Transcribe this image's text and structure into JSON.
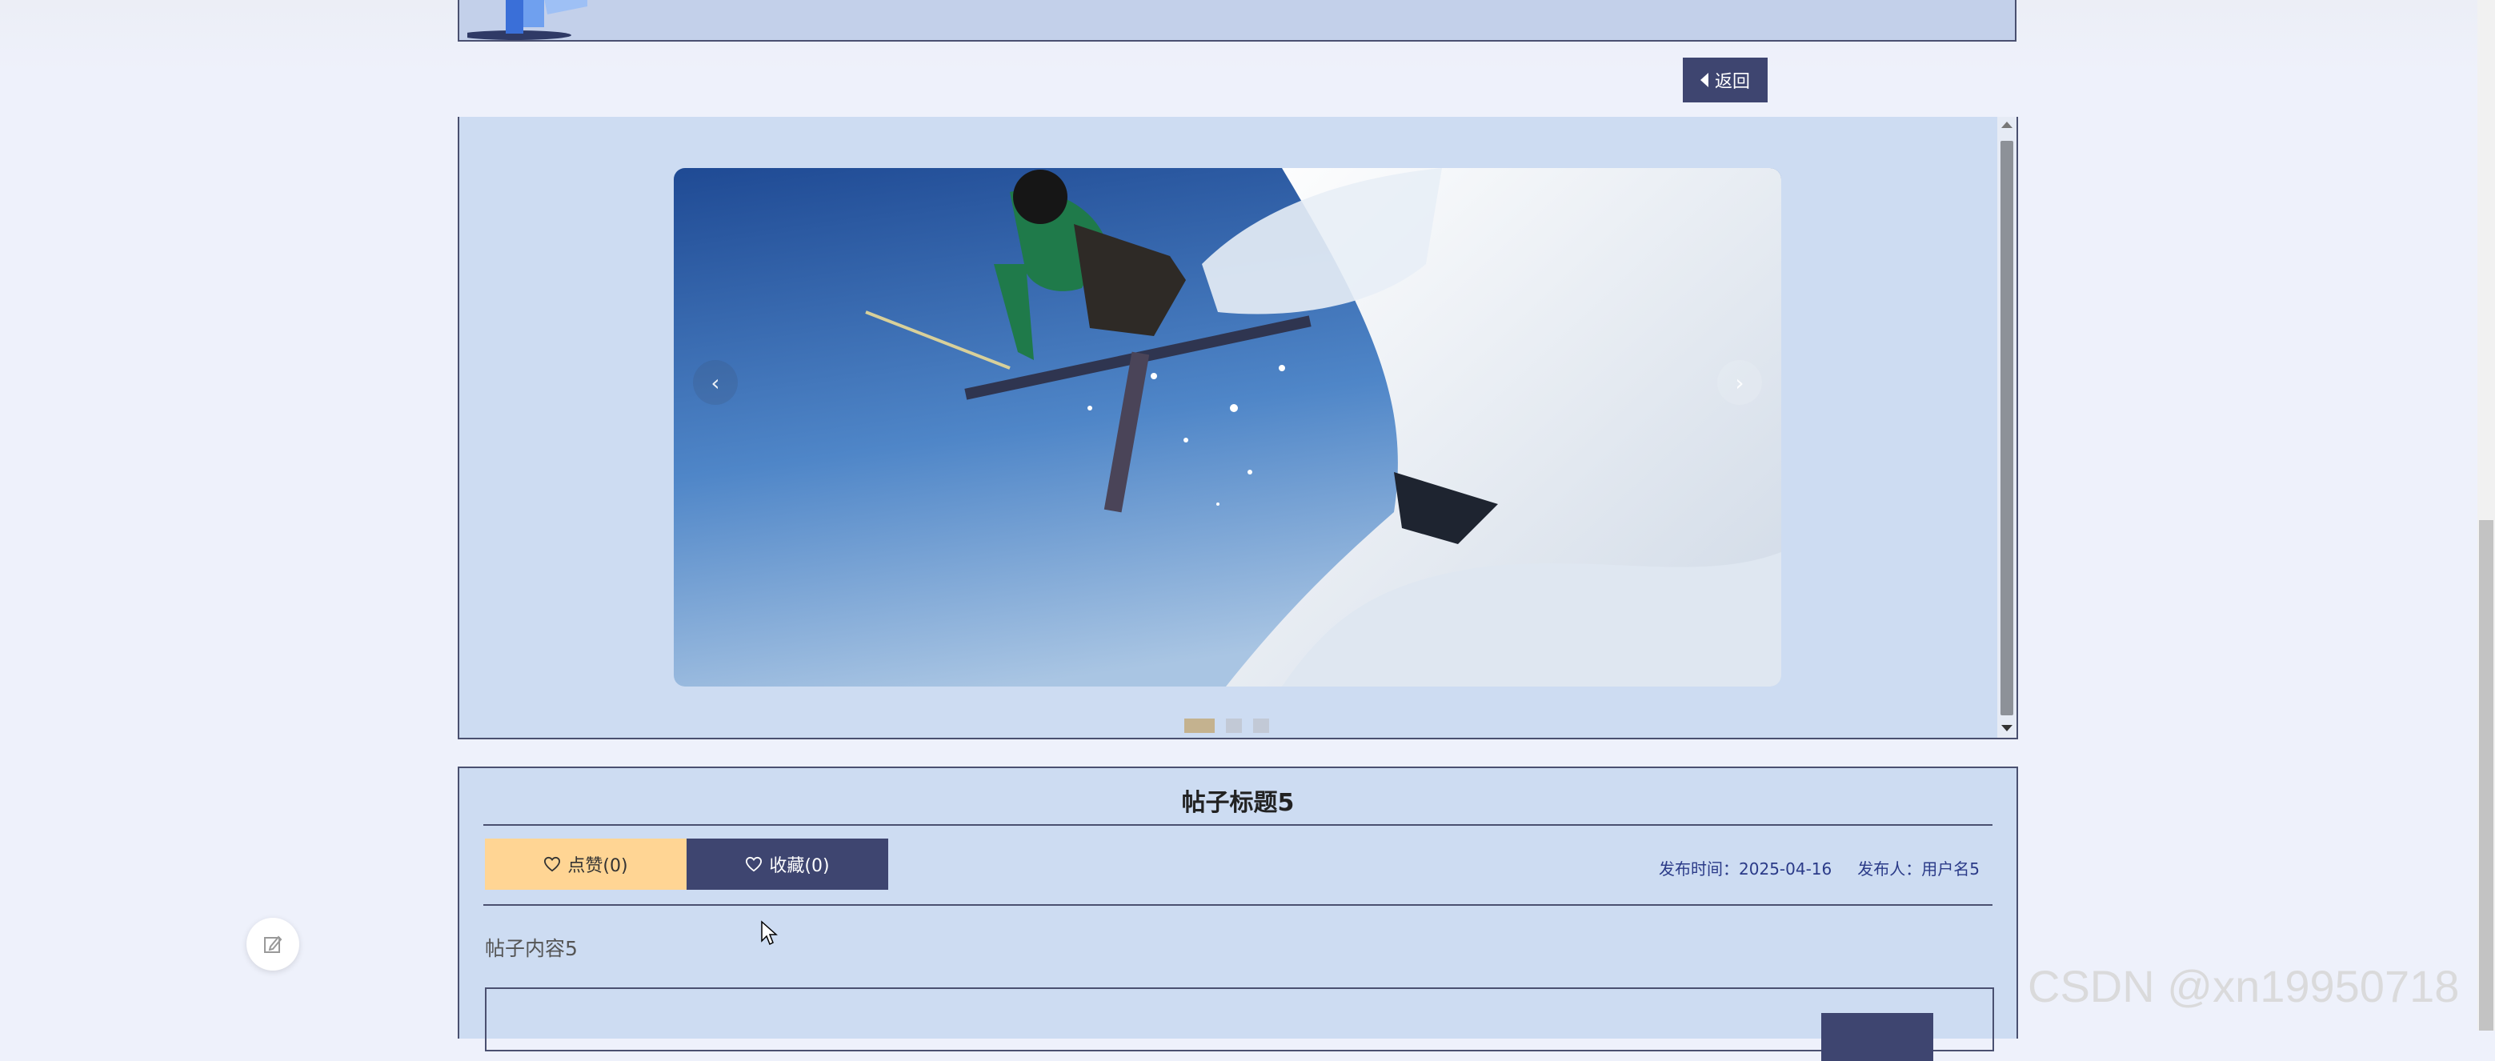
{
  "header": {
    "logo_icon": "site-logo"
  },
  "toolbar": {
    "back_label": "返回",
    "back_icon": "caret-left-icon"
  },
  "carousel": {
    "prev_label": "‹",
    "next_label": "›",
    "slide_count": 3,
    "active_index": 0,
    "slide_image": "freestyle-skier-jumping-over-snow"
  },
  "post": {
    "title": "帖子标题5",
    "like_label": "点赞(0)",
    "favorite_label": "收藏(0)",
    "publish_time": "发布时间：2025-04-16",
    "publisher": "发布人：用户名5",
    "content": "帖子内容5"
  },
  "colors": {
    "accent": "#3e4570",
    "like": "#ffd594",
    "panel": "#cddcf2",
    "meta_text": "#2a3a88"
  },
  "watermark": "CSDN @xn19950718"
}
